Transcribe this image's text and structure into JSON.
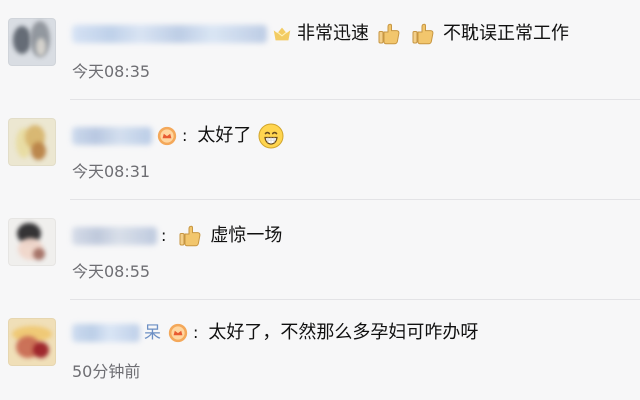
{
  "comments": [
    {
      "content": "非常迅速",
      "content_suffix": "不耽误正常工作",
      "time": "今天08:35"
    },
    {
      "content": "太好了",
      "time": "今天08:31"
    },
    {
      "content": "虚惊一场",
      "time": "今天08:55"
    },
    {
      "visible_name_suffix": "呆",
      "content": "太好了，不然那么多孕妇可咋办呀",
      "time": "50分钟前"
    }
  ],
  "colors": {
    "background": "#f5f5f7",
    "divider": "#e3e3e6",
    "time_text": "#6e6e73",
    "name_blue": "#6c8fc4"
  },
  "icons": {
    "thumbs_up": "thumbs-up-icon",
    "grin": "grinning-face-icon",
    "crown_badge": "crown-badge-icon",
    "yellow_badge": "yellow-badge-icon"
  }
}
